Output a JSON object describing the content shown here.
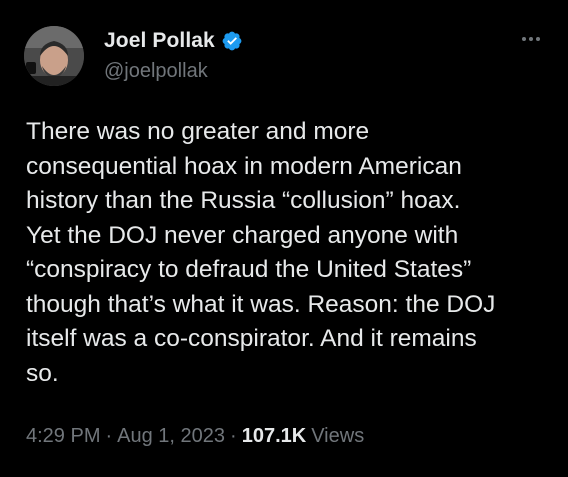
{
  "author": {
    "display_name": "Joel Pollak",
    "handle": "@joelpollak",
    "verified": true
  },
  "tweet": {
    "text": "There was no greater and more\nconsequential hoax in modern American\nhistory than the Russia “collusion” hoax.\nYet the DOJ never charged anyone with\n“conspiracy to defraud the United States”\nthough that’s what it was. Reason: the DOJ\nitself was a co-conspirator. And it remains\nso."
  },
  "meta": {
    "time": "4:29 PM",
    "separator": "·",
    "date": "Aug 1, 2023",
    "views_count": "107.1K",
    "views_label": "Views"
  },
  "colors": {
    "background": "#000000",
    "primary_text": "#e7e9ea",
    "secondary_text": "#71767b",
    "verified_badge": "#1d9bf0"
  },
  "icons": {
    "verified": "verified-badge-icon",
    "more": "more-options-icon"
  }
}
